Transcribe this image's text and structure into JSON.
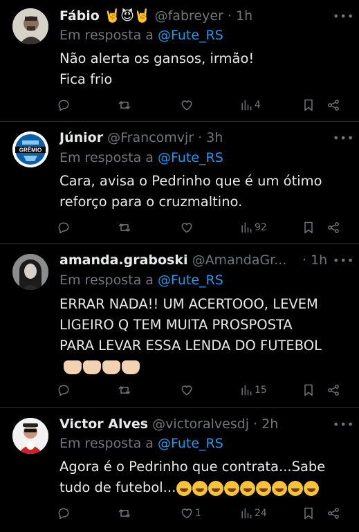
{
  "tweets": [
    {
      "name": "Fábio 🤘😈🤘",
      "handle": "@fabreyer",
      "time": "1h",
      "reply_prefix": "Em resposta a",
      "reply_to": "@Fute_RS",
      "lines": [
        "Não alerta os gansos, irmão!",
        "Fica frio"
      ],
      "replies": "",
      "retweets": "",
      "likes": "",
      "views": "4"
    },
    {
      "name": "Júnior",
      "handle": "@Francomvjr",
      "time": "3h",
      "reply_prefix": "Em resposta a",
      "reply_to": "@Fute_RS",
      "lines": [
        "Cara, avisa o Pedrinho que é um ótimo",
        "reforço para o cruzmaltino."
      ],
      "replies": "",
      "retweets": "",
      "likes": "",
      "views": "92",
      "avatar_text": "GRÊMIO"
    },
    {
      "name": "amanda.graboski",
      "handle": "@AmandaGr...",
      "time": "1h",
      "reply_prefix": "Em resposta a",
      "reply_to": "@Fute_RS",
      "lines": [
        "ERRAR NADA!! UM ACERTOOO, LEVEM",
        "LIGEIRO Q TEM MUITA PROSPOSTA",
        "PARA LEVAR ESSA LENDA DO FUTEBOL"
      ],
      "emoji_line": "🙌🏻🙌🏻🙌🏻🙌🏻",
      "replies": "",
      "retweets": "",
      "likes": "",
      "views": "15"
    },
    {
      "name": "Victor Alves",
      "handle": "@victoralvesdj",
      "time": "2h",
      "reply_prefix": "Em resposta a",
      "reply_to": "@Fute_RS",
      "lines": [
        "Agora é o Pedrinho que contrata...Sabe",
        "tudo de futebol..."
      ],
      "emoji_line": "🤣🤣🤣🤣🤣🤣🤣🤣🤣",
      "replies": "",
      "retweets": "",
      "likes": "1",
      "views": "24"
    }
  ],
  "icons": {
    "reply": "reply-icon",
    "retweet": "retweet-icon",
    "like": "heart-icon",
    "views": "views-icon",
    "bookmark": "bookmark-icon",
    "share": "share-icon",
    "more": "more-icon"
  },
  "colors": {
    "background": "#000000",
    "text": "#e7e9ea",
    "muted": "#71767b",
    "link": "#1d9bf0",
    "divider": "#2f3336"
  }
}
